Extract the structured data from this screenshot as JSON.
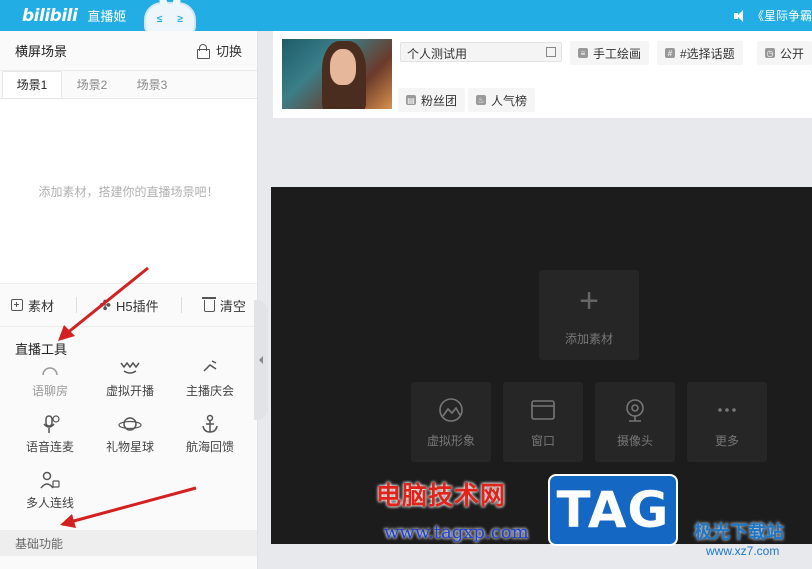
{
  "topbar": {
    "logo": "bilibili",
    "title": "直播姬",
    "marquee": "《星际争霸"
  },
  "left_panel": {
    "title": "横屏场景",
    "switch_label": "切换",
    "tabs": [
      "场景1",
      "场景2",
      "场景3"
    ],
    "empty_hint": "添加素材，搭建你的直播场景吧！",
    "toolbar": {
      "material": "素材",
      "h5": "H5插件",
      "clear": "清空"
    },
    "tools_title": "直播工具",
    "tools": [
      {
        "label": "语聊房",
        "icon": "voice-room-icon"
      },
      {
        "label": "虚拟开播",
        "icon": "virtual-stream-icon"
      },
      {
        "label": "主播庆会",
        "icon": "celebration-icon"
      },
      {
        "label": "语音连麦",
        "icon": "microphone-icon"
      },
      {
        "label": "礼物星球",
        "icon": "planet-icon"
      },
      {
        "label": "航海回馈",
        "icon": "anchor-icon"
      },
      {
        "label": "多人连线",
        "icon": "multi-user-icon"
      }
    ],
    "basic_title": "基础功能"
  },
  "room": {
    "title_value": "个人测试用",
    "chips": [
      "手工绘画",
      "#选择话题",
      "公开",
      "粉丝团",
      "人气榜"
    ]
  },
  "preview": {
    "add_material": "添加素材",
    "sources": [
      "虚拟形象",
      "窗口",
      "摄像头",
      "更多"
    ]
  },
  "watermark": {
    "site_cn": "电脑技术网",
    "url": "www.tagxp.com",
    "tag": "TAG",
    "brand_cn": "极光下载站",
    "brand_url": "www.xz7.com"
  },
  "colors": {
    "accent": "#23ade5",
    "arrow": "#d32020"
  }
}
